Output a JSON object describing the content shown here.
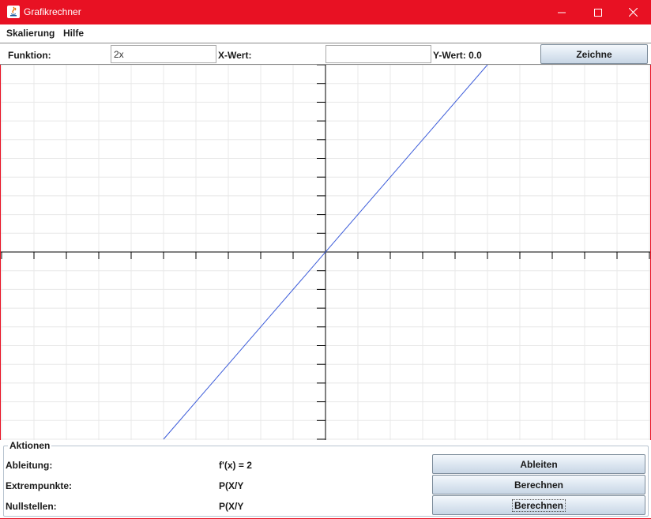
{
  "window": {
    "title": "Grafikrechner",
    "accent_color": "#e81123",
    "controls": [
      "minimize-icon",
      "maximize-icon",
      "close-icon"
    ]
  },
  "menu": {
    "items": [
      "Skalierung",
      "Hilfe"
    ]
  },
  "toolbar": {
    "function_label": "Funktion:",
    "function_value": "2x",
    "x_label": "X-Wert:",
    "x_value": "",
    "y_label": "Y-Wert: 0.0",
    "draw_button": "Zeichne"
  },
  "chart_data": {
    "type": "line",
    "function": "2x",
    "x_range": [
      -10,
      10
    ],
    "y_range": [
      -10,
      10
    ],
    "grid": true,
    "series": [
      {
        "x": [
          -5,
          5
        ],
        "y": [
          -10,
          10
        ],
        "color": "#3b5bd9"
      }
    ]
  },
  "actions": {
    "title": "Aktionen",
    "rows": [
      {
        "label": "Ableitung:",
        "value": "f'(x) = 2",
        "button": "Ableiten"
      },
      {
        "label": "Extrempunkte:",
        "value": "P(X/Y",
        "button": "Berechnen"
      },
      {
        "label": "Nullstellen:",
        "value": "P(X/Y",
        "button": "Berechnen"
      }
    ]
  }
}
